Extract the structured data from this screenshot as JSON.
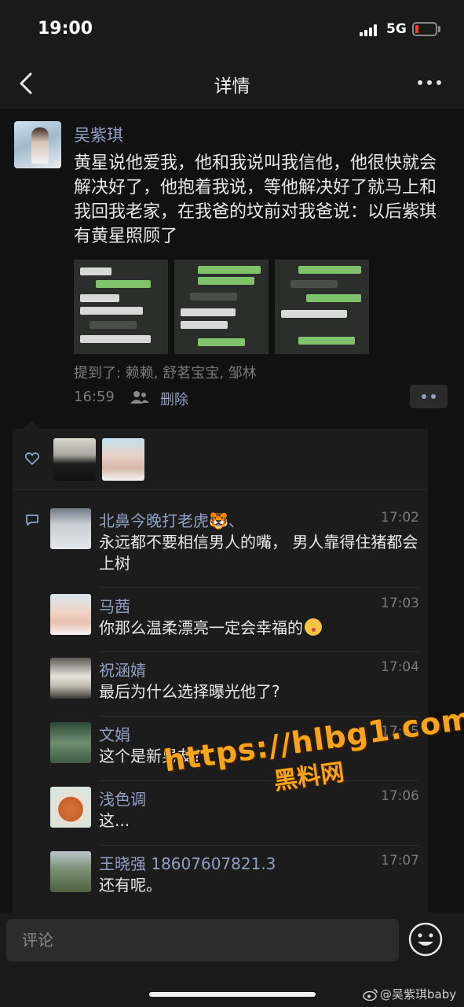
{
  "status_bar": {
    "time": "19:00",
    "network": "5G"
  },
  "nav": {
    "title": "详情"
  },
  "post": {
    "author": "吴紫琪",
    "text": "黄星说他爱我，他和我说叫我信他，他很快就会解决好了，他抱着我说，等他解决好了就马上和我回我老家，在我爸的坟前对我爸说：以后紫琪有黄星照顾了",
    "mentions": "提到了: 赖赖, 舒茗宝宝, 邹林",
    "time": "16:59",
    "delete_label": "删除"
  },
  "comments": [
    {
      "name": "北鼻今晚打老虎🐯、",
      "time": "17:02",
      "text": "永远都不要相信男人的嘴， 男人靠得住猪都会上树"
    },
    {
      "name": "马茜",
      "time": "17:03",
      "text": "你那么温柔漂亮一定会幸福的"
    },
    {
      "name": "祝涵婧",
      "time": "17:04",
      "text": "最后为什么选择曝光他了?"
    },
    {
      "name": "文娟",
      "time": "17:05",
      "text": "这个是新男友?"
    },
    {
      "name": "浅色调",
      "time": "17:06",
      "text": "这..."
    },
    {
      "name": "王晓强 18607607821.3",
      "time": "17:07",
      "text": "还有呢。"
    }
  ],
  "watermark": {
    "url": "https://hlbg1.com",
    "brand": "黑料网"
  },
  "input": {
    "placeholder": "评论"
  },
  "footer": {
    "weibo_credit": "@吴紫琪baby"
  }
}
